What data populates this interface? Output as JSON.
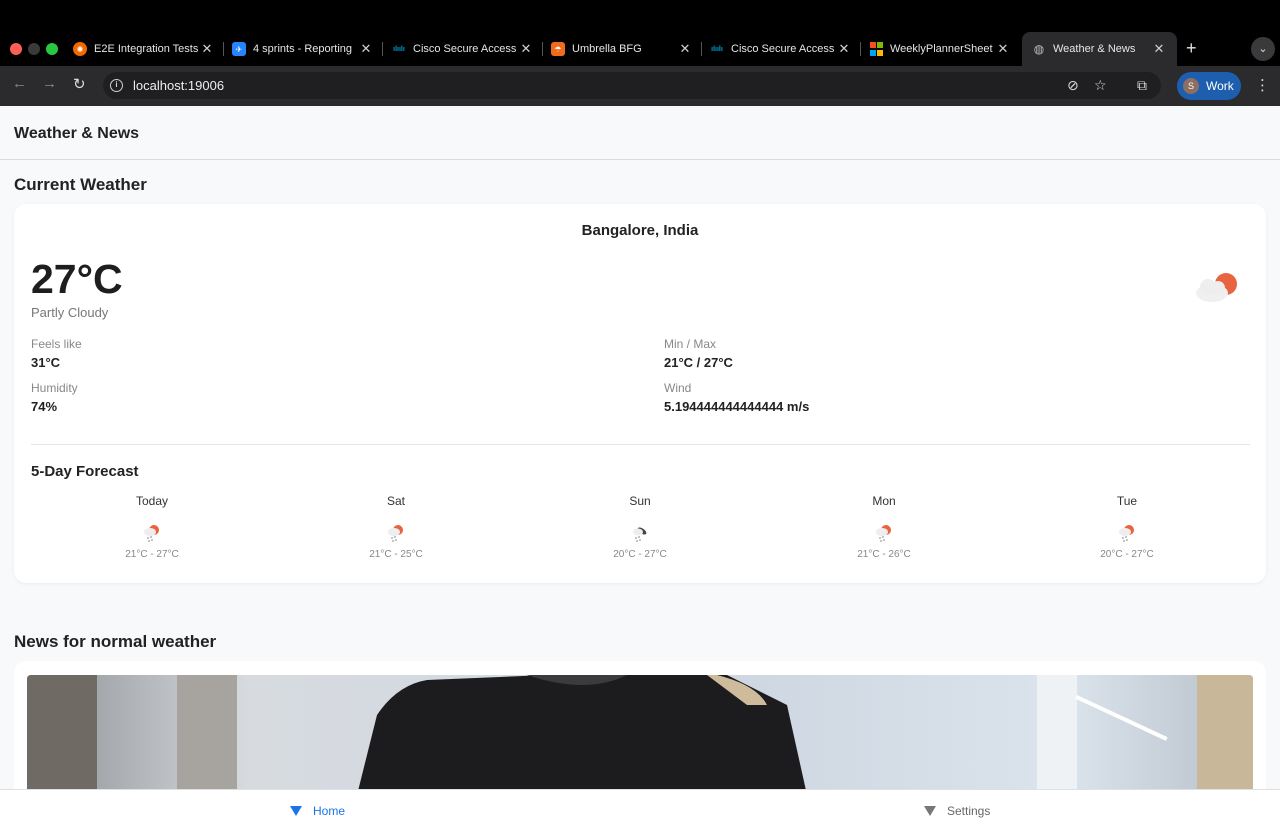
{
  "browser": {
    "tabs": [
      {
        "title": "E2E Integration Tests",
        "favicon": "grafana-icon",
        "color": "#f46800"
      },
      {
        "title": "4 sprints - Reporting",
        "favicon": "jira-icon",
        "color": "#2684ff"
      },
      {
        "title": "Cisco Secure Access",
        "favicon": "cisco-icon",
        "color": "#049fd9"
      },
      {
        "title": "Umbrella BFG",
        "favicon": "umbrella-icon",
        "color": "#f26b1d"
      },
      {
        "title": "Cisco Secure Access",
        "favicon": "cisco-icon",
        "color": "#049fd9"
      },
      {
        "title": "WeeklyPlannerSheet",
        "favicon": "microsoft-icon",
        "color": "#f25022"
      },
      {
        "title": "Weather & News",
        "favicon": "globe-icon",
        "color": "#9aa0a6"
      }
    ],
    "url": "localhost:19006",
    "profile": {
      "initial": "S",
      "label": "Work"
    }
  },
  "app": {
    "title": "Weather & News"
  },
  "current_weather": {
    "section_title": "Current Weather",
    "location": "Bangalore, India",
    "temperature": "27°C",
    "condition": "Partly Cloudy",
    "icon": "partly-cloudy-icon",
    "stats": {
      "feels_like_label": "Feels like",
      "feels_like_value": "31°C",
      "min_max_label": "Min / Max",
      "min_max_value": "21°C / 27°C",
      "humidity_label": "Humidity",
      "humidity_value": "74%",
      "wind_label": "Wind",
      "wind_value": "5.194444444444444 m/s"
    }
  },
  "forecast": {
    "title": "5-Day Forecast",
    "days": [
      {
        "day": "Today",
        "range": "21°C - 27°C",
        "icon": "light-rain-icon"
      },
      {
        "day": "Sat",
        "range": "21°C - 25°C",
        "icon": "light-rain-icon"
      },
      {
        "day": "Sun",
        "range": "20°C - 27°C",
        "icon": "rain-night-icon"
      },
      {
        "day": "Mon",
        "range": "21°C - 26°C",
        "icon": "light-rain-icon"
      },
      {
        "day": "Tue",
        "range": "20°C - 27°C",
        "icon": "light-rain-icon"
      }
    ]
  },
  "news": {
    "section_title": "News for normal weather"
  },
  "bottom_nav": {
    "home_label": "Home",
    "settings_label": "Settings",
    "active_color": "#1a73e8",
    "inactive_color": "#666666"
  }
}
